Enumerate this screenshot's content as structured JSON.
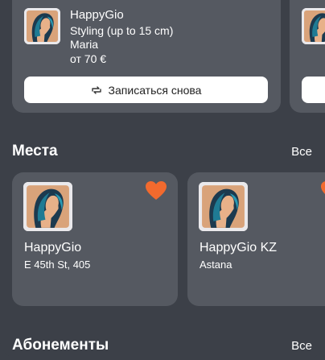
{
  "booking": {
    "salon": "HappyGio",
    "service": "Styling (up to 15 cm)",
    "master": "Maria",
    "price": "от 70 €",
    "rebook_label": "Записаться снова"
  },
  "places_section": {
    "title": "Места",
    "all_label": "Все",
    "items": [
      {
        "name": "HappyGio",
        "address": "E 45th St, 405",
        "favorite": true
      },
      {
        "name": "HappyGio KZ",
        "address": "Astana",
        "favorite": true
      }
    ]
  },
  "subscriptions_section": {
    "title": "Абонементы",
    "all_label": "Все"
  },
  "colors": {
    "accent": "#f26a2e",
    "background": "#3c4048",
    "card": "#555961"
  }
}
